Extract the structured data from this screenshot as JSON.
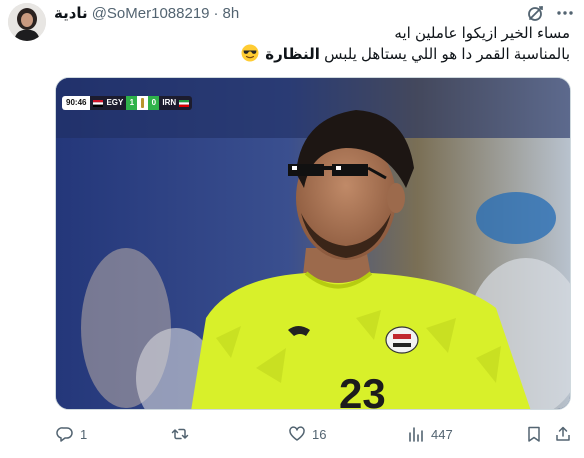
{
  "post": {
    "display_name": "نادية",
    "handle": "@SoMer1088219",
    "separator": "·",
    "time": "8h",
    "text_line_1": "مساء الخير ازيكوا  عاملين ايه",
    "text_line_2_prefix": "بالمناسبة القمر دا هو اللي يستاهل يلبس ",
    "text_line_2_bold": "النظارة",
    "emoji": "smiling-face-with-sunglasses"
  },
  "media": {
    "scorebug": {
      "clock": "90:46",
      "home_team": "EGY",
      "home_score": "1",
      "away_score": "0",
      "away_team": "IRN"
    },
    "jersey_number": "23"
  },
  "actions": {
    "reply_count": "1",
    "retweet_count": "",
    "like_count": "16",
    "views_count": "447"
  },
  "colors": {
    "text": "#0f1419",
    "secondary": "#536471",
    "border": "#cfd9de",
    "jersey": "#d8f02a",
    "scorebug_green": "#2fb24a"
  }
}
